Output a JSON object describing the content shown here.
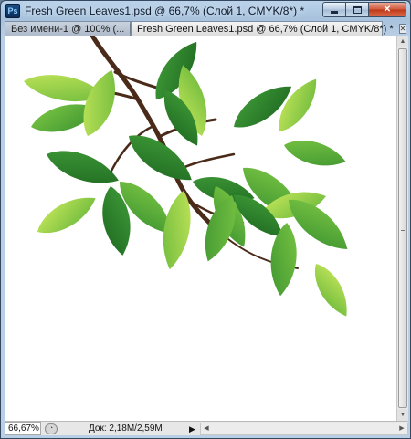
{
  "window": {
    "app_icon": "Ps",
    "title": "Fresh Green Leaves1.psd @ 66,7% (Слой 1, CMYK/8*) *",
    "buttons": [
      "minimize-icon",
      "maximize-icon",
      "close-icon"
    ],
    "close_glyph": "✕"
  },
  "tabs": [
    {
      "label": "Без имени-1 @ 100% (...",
      "active": false
    },
    {
      "label": "Fresh Green Leaves1.psd @ 66,7% (Слой 1, CMYK/8*) *",
      "active": true
    }
  ],
  "tab_close_glyph": "✕",
  "canvas": {
    "image": "fresh-green-leaves-branch",
    "background": "#ffffff",
    "leaf_colors": [
      "#2f7d2f",
      "#4ea33a",
      "#7cc444",
      "#a6d94d"
    ],
    "branch_color": "#4a2b1a"
  },
  "statusbar": {
    "zoom": "66,67%",
    "doc_info": "Док: 2,18M/2,59M",
    "menu_arrow": "▶"
  },
  "scroll_arrows": {
    "up": "▲",
    "down": "▼",
    "left": "◀",
    "right": "▶"
  }
}
